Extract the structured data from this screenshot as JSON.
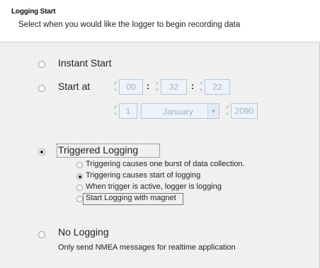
{
  "header": {
    "title": "Logging Start",
    "subtitle": "Select when you would like the logger to begin recording data"
  },
  "options": {
    "instant": {
      "label": "Instant Start",
      "selected": false
    },
    "start_at": {
      "label": "Start at",
      "selected": false,
      "time": {
        "hour": "00",
        "minute": "32",
        "second": "22",
        "separator": ":"
      },
      "date": {
        "day": "1",
        "month": "January",
        "year": "2090"
      }
    },
    "triggered": {
      "label": "Triggered Logging",
      "selected": true,
      "sub_options": [
        {
          "label": "Triggering causes one burst of data collection.",
          "selected": false
        },
        {
          "label": "Triggering causes start of logging",
          "selected": true
        },
        {
          "label": "When trigger is active, logger is logging",
          "selected": false
        },
        {
          "label": "Start Logging with magnet",
          "selected": false
        }
      ]
    },
    "no_logging": {
      "label": "No Logging",
      "description": "Only send NMEA messages for realtime application",
      "selected": false
    }
  },
  "colors": {
    "disabled_text": "#9fb2c8",
    "disabled_border": "#b3c7dc",
    "header_bg": "#ffffff",
    "panel_bg": "#f0f0f0"
  },
  "icons": {
    "spin_up": "▲",
    "spin_down": "▼",
    "dropdown": "▼"
  }
}
